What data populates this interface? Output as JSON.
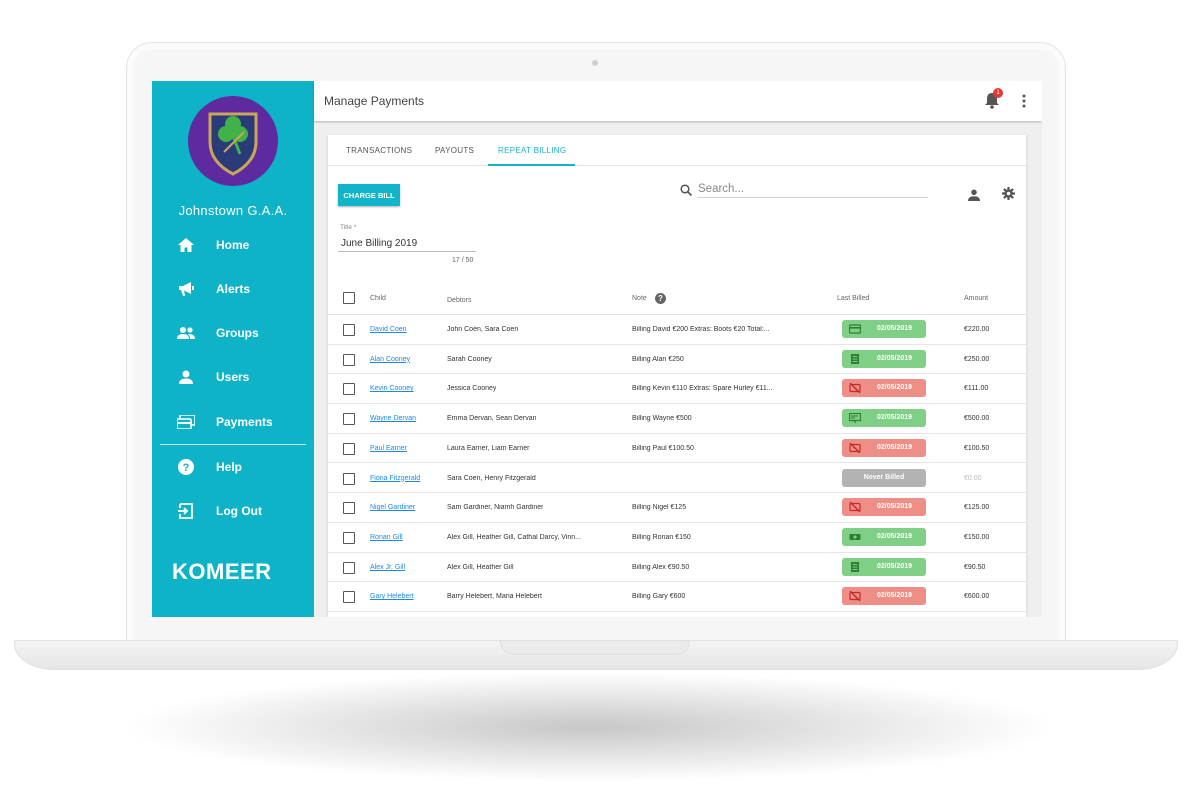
{
  "sidebar": {
    "club_name": "Johnstown G.A.A.",
    "items": [
      {
        "label": "Home",
        "icon": "home-icon"
      },
      {
        "label": "Alerts",
        "icon": "megaphone-icon"
      },
      {
        "label": "Groups",
        "icon": "groups-icon"
      },
      {
        "label": "Users",
        "icon": "user-icon"
      },
      {
        "label": "Payments",
        "icon": "payment-icon"
      },
      {
        "label": "Help",
        "icon": "help-icon"
      },
      {
        "label": "Log Out",
        "icon": "logout-icon"
      }
    ],
    "logo_text": "KOMEER",
    "color": "#0fb3c8"
  },
  "header": {
    "title": "Manage Payments",
    "notification_count": "1"
  },
  "tabs": [
    {
      "label": "TRANSACTIONS",
      "active": false
    },
    {
      "label": "PAYOUTS",
      "active": false
    },
    {
      "label": "REPEAT BILLING",
      "active": true
    }
  ],
  "toolbar": {
    "charge_label": "CHARGE BILL",
    "search_placeholder": "Search..."
  },
  "title_field": {
    "label": "Title *",
    "value": "June Billing 2019",
    "counter": "17 / 50"
  },
  "table": {
    "headers": {
      "child": "Child",
      "debtors": "Debtors",
      "note": "Note",
      "last_billed": "Last Billed",
      "amount": "Amount"
    },
    "rows": [
      {
        "child": "David Coen",
        "debtors": "John Coen, Sara Coen",
        "note": "Billing David €200 Extras: Boots €20 Total:...",
        "status": "green",
        "icon": "card-icon",
        "last_billed": "02/05/2019",
        "amount": "€220.00"
      },
      {
        "child": "Alan Cooney",
        "debtors": "Sarah Cooney",
        "note": "Billing Alan €250",
        "status": "green",
        "icon": "invoice-icon",
        "last_billed": "02/05/2019",
        "amount": "€250.00"
      },
      {
        "child": "Kevin Cooney",
        "debtors": "Jessica Cooney",
        "note": "Billing Kevin €110 Extras: Spare Hurley €11...",
        "status": "red",
        "icon": "failed-card-icon",
        "last_billed": "02/05/2019",
        "amount": "€111.00"
      },
      {
        "child": "Wayne Dervan",
        "debtors": "Emma Dervan, Sean Dervan",
        "note": "Billing Wayne €500",
        "status": "green",
        "icon": "cheque-icon",
        "last_billed": "02/05/2019",
        "amount": "€500.00"
      },
      {
        "child": "Paul Earner",
        "debtors": "Laura Earner, Liam Earner",
        "note": "Billing Paul €100.50",
        "status": "red",
        "icon": "failed-card-icon",
        "last_billed": "02/05/2019",
        "amount": "€100.50"
      },
      {
        "child": "Fiona Fitzgerald",
        "debtors": "Sara Coen, Henry Fitzgerald",
        "note": "",
        "status": "grey",
        "icon": "",
        "last_billed": "Never Billed",
        "amount": "€0.00"
      },
      {
        "child": "Nigel Gardiner",
        "debtors": "Sam Gardiner, Niamh Gardiner",
        "note": "Billing Nigel €125",
        "status": "red",
        "icon": "failed-card-icon",
        "last_billed": "02/05/2019",
        "amount": "€125.00"
      },
      {
        "child": "Ronan Gill",
        "debtors": "Alex Gill, Heather Gill, Cathal Darcy, Vinn...",
        "note": "Billing Ronan €150",
        "status": "green",
        "icon": "cash-icon",
        "last_billed": "02/05/2019",
        "amount": "€150.00"
      },
      {
        "child": "Alex Jr. Gill",
        "debtors": "Alex Gill, Heather Gill",
        "note": "Billing Alex €90.50",
        "status": "green",
        "icon": "invoice-icon",
        "last_billed": "02/05/2019",
        "amount": "€90.50"
      },
      {
        "child": "Gary Helebert",
        "debtors": "Barry Helebert, Maria Helebert",
        "note": "Billing Gary €600",
        "status": "red",
        "icon": "failed-card-icon",
        "last_billed": "02/05/2019",
        "amount": "€600.00"
      }
    ]
  },
  "colors": {
    "accent": "#16b4c9",
    "paid": "#7fcf86",
    "failed": "#ef8e86",
    "never": "#b3b3b3",
    "link": "#1e88e5"
  }
}
